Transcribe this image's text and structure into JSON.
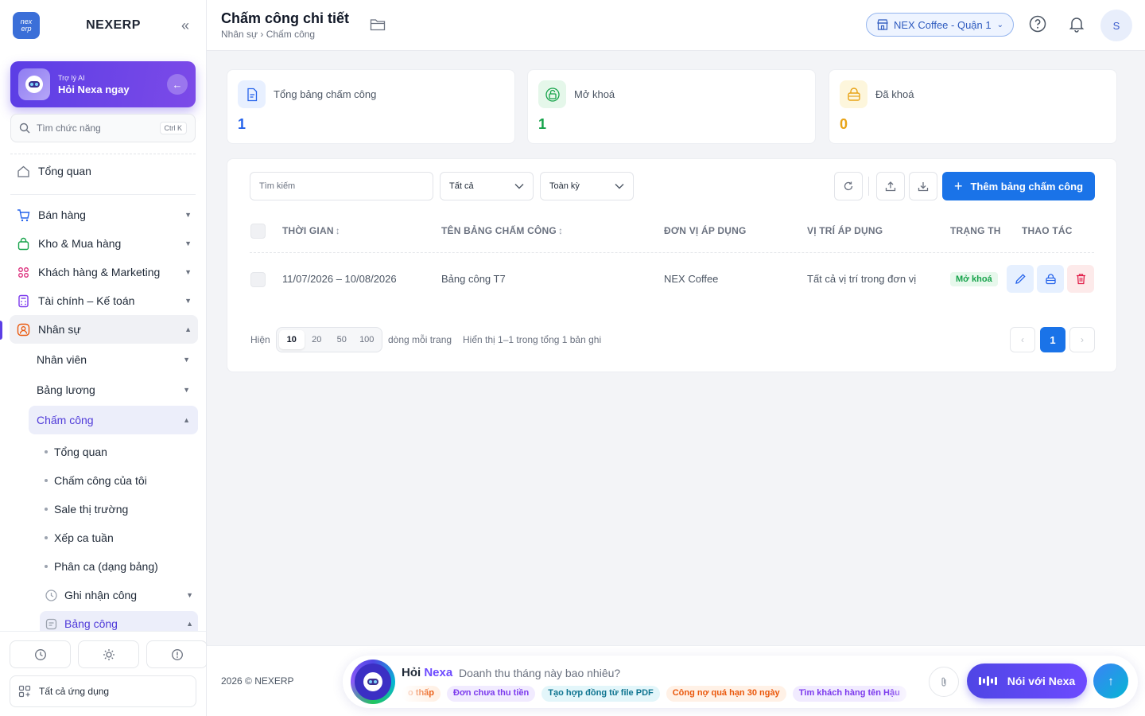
{
  "app": {
    "brand": "NEXERP",
    "logo_top": "nex",
    "logo_bottom": "erp"
  },
  "sidebar": {
    "ai_card": {
      "small": "Trợ lý AI",
      "title": "Hỏi Nexa ngay"
    },
    "search": {
      "placeholder": "Tìm chức năng",
      "shortcut": "Ctrl K"
    },
    "overview": "Tổng quan",
    "groups": [
      {
        "label": "Bán hàng"
      },
      {
        "label": "Kho & Mua hàng"
      },
      {
        "label": "Khách hàng & Marketing"
      },
      {
        "label": "Tài chính – Kế toán"
      },
      {
        "label": "Nhân sự"
      }
    ],
    "hr_children": [
      "Nhân viên",
      "Bảng lương",
      "Chấm công"
    ],
    "attendance_children": [
      "Tổng quan",
      "Chấm công của tôi",
      "Sale thị trường",
      "Xếp ca tuần",
      "Phân ca (dạng bảng)"
    ],
    "attendance_sub_groups": [
      "Ghi nhận công",
      "Bảng công"
    ],
    "all_apps": "Tất cả ứng dụng"
  },
  "header": {
    "title": "Chấm công chi tiết",
    "breadcrumb": "Nhân sự › Chấm công",
    "branch": "NEX Coffee - Quận 1",
    "user_initial": "S"
  },
  "stats": [
    {
      "label": "Tổng bảng chấm công",
      "value": "1",
      "color": "#2563eb"
    },
    {
      "label": "Mở khoá",
      "value": "1",
      "color": "#16a34a"
    },
    {
      "label": "Đã khoá",
      "value": "0",
      "color": "#e8a317"
    }
  ],
  "toolbar": {
    "search_placeholder": "Tìm kiếm",
    "filter_status": "Tất cả",
    "filter_period": "Toàn kỳ",
    "add_label": "Thêm bảng chấm công"
  },
  "table": {
    "columns": [
      "THỜI GIAN",
      "TÊN BẢNG CHẤM CÔNG",
      "ĐƠN VỊ ÁP DỤNG",
      "VỊ TRÍ ÁP DỤNG",
      "TRẠNG TH",
      "THAO TÁC"
    ],
    "rows": [
      {
        "time": "11/07/2026 – 10/08/2026",
        "name": "Bảng công T7",
        "unit": "NEX Coffee",
        "position": "Tất cả vị trí trong đơn vị",
        "status": "Mở khoá"
      }
    ]
  },
  "pagination": {
    "show_label": "Hiện",
    "sizes": [
      "10",
      "20",
      "50",
      "100"
    ],
    "per_page_label": "dòng mỗi trang",
    "summary": "Hiển thị 1–1 trong tổng 1 bản ghi",
    "current_page": "1"
  },
  "footer": {
    "copyright": "2026 © NEXERP",
    "ask_prefix": "Hỏi",
    "ask_name": "Nexa",
    "ask_question": "Doanh thu tháng này bao nhiêu?",
    "chips": [
      "o thấp",
      "Đơn chưa thu tiền",
      "Tạo hợp đồng từ file PDF",
      "Công nợ quá hạn 30 ngày",
      "Tìm khách hàng tên Hậu"
    ],
    "voice_label": "Nói với Nexa"
  }
}
